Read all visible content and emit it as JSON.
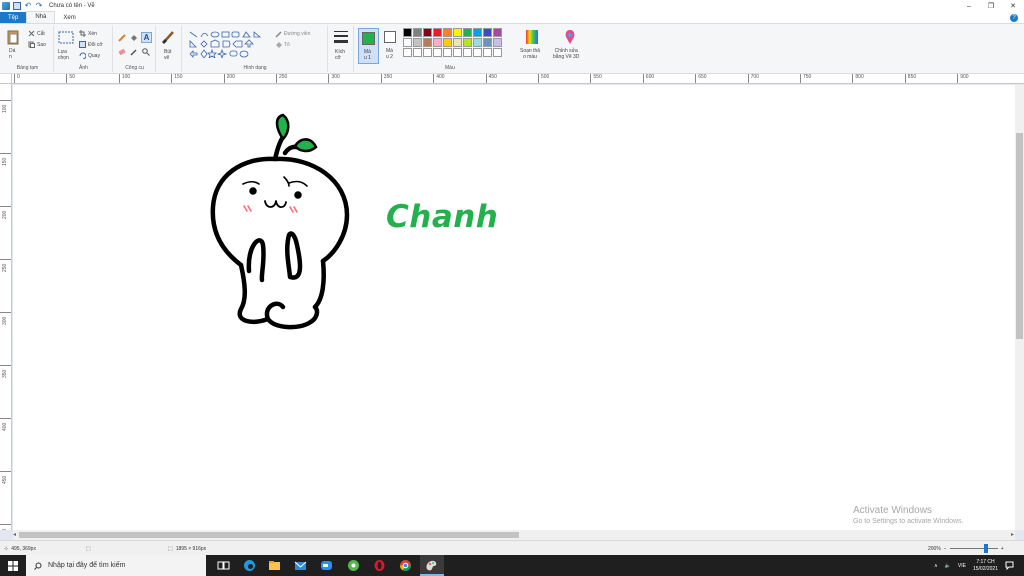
{
  "window": {
    "title": "Chưa có tên - Vẽ",
    "controls": {
      "minimize": "–",
      "maximize": "❐",
      "close": "✕"
    }
  },
  "tabs": [
    {
      "label": "Tệp"
    },
    {
      "label": "Nhà"
    },
    {
      "label": "Xem"
    }
  ],
  "help_glyph": "?",
  "ribbon": {
    "clipboard": {
      "label": "Bảng tạm",
      "paste": "Dá\nn",
      "cut": "Cắt",
      "copy": "Sao"
    },
    "image": {
      "label": "Ảnh",
      "select": "Lựa\nchọn",
      "crop": "Xén",
      "resize": "Đổi cỡ",
      "rotate": "Quay"
    },
    "tools": {
      "label": "Công cụ"
    },
    "brushes": {
      "label": "Bút\nvẽ"
    },
    "shapes": {
      "label": "Hình dạng",
      "outline": "Đường viền",
      "fill": "Tô"
    },
    "size": {
      "label": "Kích\ncỡ"
    },
    "colors": {
      "label": "Màu",
      "color1_label": "Mà\nu 1",
      "color2_label": "Mà\nu 2",
      "edit_colors": "Soạn thả\no màu",
      "paint3d": "Chỉnh sửa\nbằng Vẽ 3D",
      "color1": "#22b14c",
      "color2": "#ffffff",
      "row1": [
        "#000000",
        "#7f7f7f",
        "#880015",
        "#ed1c24",
        "#ff7f27",
        "#fff200",
        "#22b14c",
        "#00a2e8",
        "#3f48cc",
        "#a349a4"
      ],
      "row2": [
        "#ffffff",
        "#c3c3c3",
        "#b97a57",
        "#ffaec9",
        "#ffc90e",
        "#efe4b0",
        "#b5e61d",
        "#99d9ea",
        "#7092be",
        "#c8bfe7"
      ],
      "row3": [
        "#ffffff",
        "#ffffff",
        "#ffffff",
        "#ffffff",
        "#ffffff",
        "#ffffff",
        "#ffffff",
        "#ffffff",
        "#ffffff",
        "#ffffff"
      ]
    }
  },
  "ruler_h": [
    "0",
    "50",
    "100",
    "150",
    "200",
    "250",
    "300",
    "350",
    "400",
    "450",
    "500",
    "550",
    "600",
    "650",
    "700",
    "750",
    "800",
    "850",
    "900"
  ],
  "ruler_v": [
    "100",
    "150",
    "200",
    "250",
    "300",
    "350",
    "400",
    "450",
    "500"
  ],
  "canvas": {
    "text": "Chanh",
    "text_color": "#22b14c",
    "icons": [
      "lemon-character-drawing",
      "sprout-icon"
    ]
  },
  "watermark": {
    "line1": "Activate Windows",
    "line2": "Go to Settings to activate Windows."
  },
  "statusbar": {
    "cursor_pos": "495, 369px",
    "canvas_size": "1895 × 916px",
    "zoom": "200%",
    "zoom_minus": "−",
    "zoom_plus": "+"
  },
  "taskbar": {
    "search_placeholder": "Nhập tại đây để tìm kiếm",
    "lang": "VIE",
    "time": "7:17 CH",
    "date": "15/02/2021",
    "tray_up": "∧",
    "volume": "🔈"
  }
}
